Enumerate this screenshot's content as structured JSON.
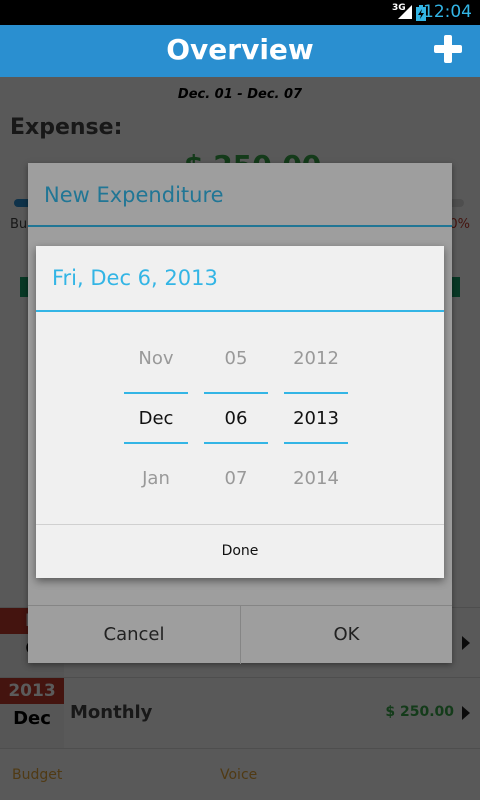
{
  "status_bar": {
    "network": "3G",
    "time": "12:04"
  },
  "header": {
    "title": "Overview"
  },
  "overview": {
    "date_range": "Dec. 01 - Dec. 07",
    "expense_label": "Expense:",
    "expense_amount": "$ 250.00",
    "budget_label": "Bu",
    "percent_label": "0%",
    "progress_fraction": 0.08
  },
  "list": {
    "rows": [
      {
        "year": "D",
        "month": "C",
        "title": "",
        "amount": ""
      },
      {
        "year": "2013",
        "month": "Dec",
        "title": "Monthly",
        "amount": "$ 250.00"
      }
    ]
  },
  "bottom_tabs": {
    "budget": "Budget",
    "voice": "Voice"
  },
  "expenditure_dialog": {
    "title": "New Expenditure",
    "cancel": "Cancel",
    "ok": "OK"
  },
  "date_picker": {
    "title": "Fri, Dec 6, 2013",
    "month": {
      "prev": "Nov",
      "current": "Dec",
      "next": "Jan"
    },
    "day": {
      "prev": "05",
      "current": "06",
      "next": "07"
    },
    "year": {
      "prev": "2012",
      "current": "2013",
      "next": "2014"
    },
    "done": "Done"
  },
  "colors": {
    "accent": "#33b5e5",
    "header": "#2a8fd0",
    "positive": "#3aa64a",
    "warning": "#c0392b"
  }
}
